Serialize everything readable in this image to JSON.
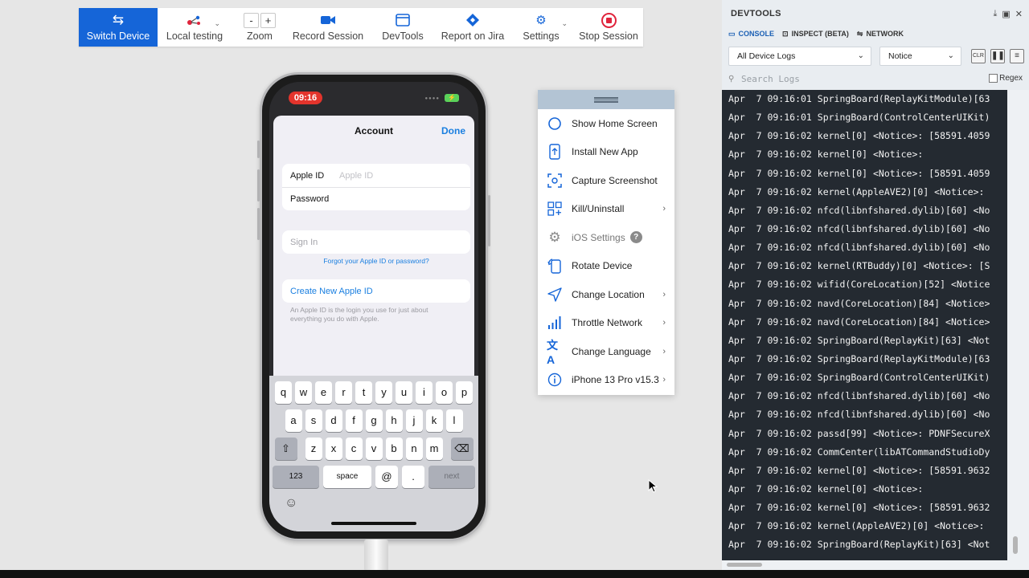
{
  "toolbar": {
    "switch_device": "Switch Device",
    "local_testing": "Local testing",
    "zoom": "Zoom",
    "zoom_minus": "-",
    "zoom_plus": "+",
    "record_session": "Record Session",
    "devtools": "DevTools",
    "report_jira": "Report on Jira",
    "settings": "Settings",
    "stop_session": "Stop Session"
  },
  "phone": {
    "status_time": "09:16",
    "sheet_title": "Account",
    "done": "Done",
    "apple_id_label": "Apple ID",
    "apple_id_placeholder": "Apple ID",
    "password_label": "Password",
    "sign_in": "Sign In",
    "forgot": "Forgot your Apple ID or password?",
    "create": "Create New Apple ID",
    "hint": "An Apple ID is the login you use for just about everything you do with Apple.",
    "keyboard": {
      "row1": [
        "q",
        "w",
        "e",
        "r",
        "t",
        "y",
        "u",
        "i",
        "o",
        "p"
      ],
      "row2": [
        "a",
        "s",
        "d",
        "f",
        "g",
        "h",
        "j",
        "k",
        "l"
      ],
      "row3": [
        "z",
        "x",
        "c",
        "v",
        "b",
        "n",
        "m"
      ],
      "k123": "123",
      "space": "space",
      "at": "@",
      "dot": ".",
      "next": "next"
    }
  },
  "menu": {
    "items": [
      {
        "label": "Show Home Screen",
        "icon": "circle-icon",
        "submenu": false
      },
      {
        "label": "Install New App",
        "icon": "install-app-icon",
        "submenu": false
      },
      {
        "label": "Capture Screenshot",
        "icon": "screenshot-icon",
        "submenu": false
      },
      {
        "label": "Kill/Uninstall",
        "icon": "apps-grid-icon",
        "submenu": true
      },
      {
        "label": "iOS Settings",
        "icon": "gear-icon",
        "submenu": false
      },
      {
        "label": "Rotate Device",
        "icon": "rotate-icon",
        "submenu": false
      },
      {
        "label": "Change Location",
        "icon": "location-arrow-icon",
        "submenu": true
      },
      {
        "label": "Throttle Network",
        "icon": "signal-bars-icon",
        "submenu": true
      },
      {
        "label": "Change Language",
        "icon": "translate-icon",
        "submenu": true
      },
      {
        "label": "iPhone 13 Pro  v15.3",
        "icon": "info-icon",
        "submenu": true
      }
    ]
  },
  "devtools": {
    "title": "DEVTOOLS",
    "tabs": [
      "CONSOLE",
      "INSPECT (BETA)",
      "NETWORK"
    ],
    "log_source": "All Device Logs",
    "log_level": "Notice",
    "clear": "CLR",
    "search_placeholder": "Search Logs",
    "regex": "Regex",
    "logs": [
      "Apr  7 09:16:01 SpringBoard(ReplayKitModule)[63",
      "Apr  7 09:16:01 SpringBoard(ControlCenterUIKit)",
      "Apr  7 09:16:02 kernel[0] <Notice>: [58591.4059",
      "Apr  7 09:16:02 kernel[0] <Notice>:",
      "Apr  7 09:16:02 kernel[0] <Notice>: [58591.4059",
      "Apr  7 09:16:02 kernel(AppleAVE2)[0] <Notice>:",
      "Apr  7 09:16:02 nfcd(libnfshared.dylib)[60] <No",
      "Apr  7 09:16:02 nfcd(libnfshared.dylib)[60] <No",
      "Apr  7 09:16:02 nfcd(libnfshared.dylib)[60] <No",
      "Apr  7 09:16:02 kernel(RTBuddy)[0] <Notice>: [S",
      "Apr  7 09:16:02 wifid(CoreLocation)[52] <Notice",
      "Apr  7 09:16:02 navd(CoreLocation)[84] <Notice>",
      "Apr  7 09:16:02 navd(CoreLocation)[84] <Notice>",
      "Apr  7 09:16:02 SpringBoard(ReplayKit)[63] <Not",
      "Apr  7 09:16:02 SpringBoard(ReplayKitModule)[63",
      "Apr  7 09:16:02 SpringBoard(ControlCenterUIKit)",
      "Apr  7 09:16:02 nfcd(libnfshared.dylib)[60] <No",
      "Apr  7 09:16:02 nfcd(libnfshared.dylib)[60] <No",
      "Apr  7 09:16:02 passd[99] <Notice>: PDNFSecureX",
      "Apr  7 09:16:02 CommCenter(libATCommandStudioDy",
      "Apr  7 09:16:02 kernel[0] <Notice>: [58591.9632",
      "Apr  7 09:16:02 kernel[0] <Notice>:",
      "Apr  7 09:16:02 kernel[0] <Notice>: [58591.9632",
      "Apr  7 09:16:02 kernel(AppleAVE2)[0] <Notice>:",
      "Apr  7 09:16:02 SpringBoard(ReplayKit)[63] <Not"
    ]
  },
  "colors": {
    "accent": "#1565d8",
    "stop_red": "#e0243c",
    "console_bg": "#242a31",
    "ios_blue": "#1a7fe0"
  }
}
